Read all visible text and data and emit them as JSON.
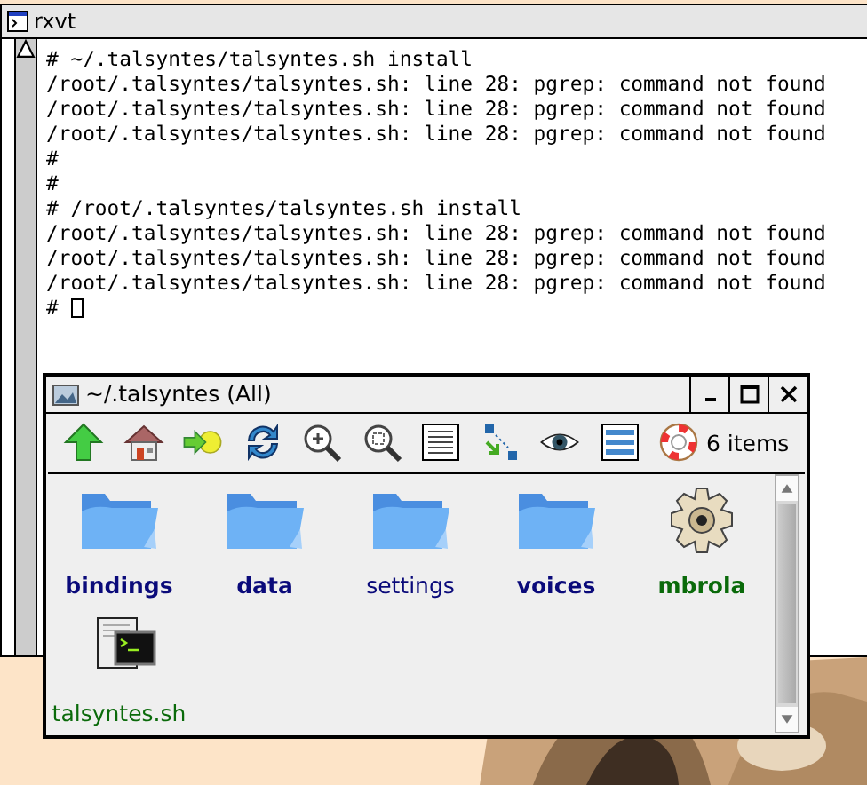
{
  "terminal": {
    "title": "rxvt",
    "lines": [
      "# ~/.talsyntes/talsyntes.sh install",
      "/root/.talsyntes/talsyntes.sh: line 28: pgrep: command not found",
      "/root/.talsyntes/talsyntes.sh: line 28: pgrep: command not found",
      "/root/.talsyntes/talsyntes.sh: line 28: pgrep: command not found",
      "#",
      "#",
      "# /root/.talsyntes/talsyntes.sh install",
      "/root/.talsyntes/talsyntes.sh: line 28: pgrep: command not found",
      "/root/.talsyntes/talsyntes.sh: line 28: pgrep: command not found",
      "/root/.talsyntes/talsyntes.sh: line 28: pgrep: command not found"
    ],
    "prompt": "#",
    "cursor": true
  },
  "filer": {
    "title": "~/.talsyntes (All)",
    "status": "6 items",
    "items": [
      {
        "name": "bindings",
        "kind": "folder",
        "bold": true,
        "color": "#0a0a7a"
      },
      {
        "name": "data",
        "kind": "folder",
        "bold": true,
        "color": "#0a0a7a"
      },
      {
        "name": "settings",
        "kind": "folder",
        "bold": false,
        "color": "#0a0a7a"
      },
      {
        "name": "voices",
        "kind": "folder",
        "bold": true,
        "color": "#0a0a7a"
      },
      {
        "name": "mbrola",
        "kind": "gear",
        "bold": true,
        "color": "#0a6a0a"
      },
      {
        "name": "talsyntes.sh",
        "kind": "script",
        "bold": false,
        "color": "#0a6a0a"
      }
    ]
  }
}
